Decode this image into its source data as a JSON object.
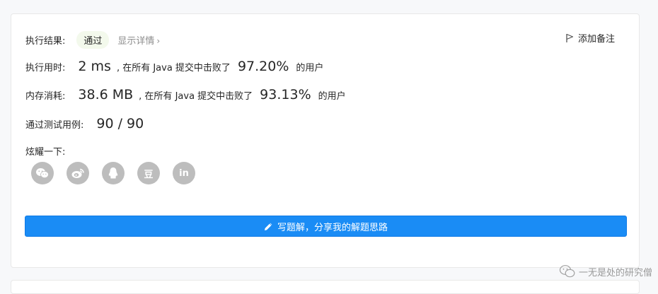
{
  "result": {
    "label": "执行结果:",
    "status": "通过",
    "details_link": "显示详情",
    "details_chevron": "›"
  },
  "add_note": {
    "label": "添加备注"
  },
  "runtime": {
    "label": "执行用时:",
    "value": "2 ms",
    "beat_text": ", 在所有 Java 提交中击败了",
    "percent": "97.20%",
    "users_text": "的用户"
  },
  "memory": {
    "label": "内存消耗:",
    "value": "38.6 MB",
    "beat_text": ", 在所有 Java 提交中击败了",
    "percent": "93.13%",
    "users_text": "的用户"
  },
  "testcases": {
    "label": "通过测试用例:",
    "value": "90 / 90"
  },
  "share": {
    "label": "炫耀一下:",
    "icons": [
      "wechat-icon",
      "weibo-icon",
      "qq-icon",
      "douban-icon",
      "linkedin-icon"
    ],
    "douban_glyph": "豆",
    "linkedin_glyph": "in"
  },
  "solution_button": {
    "label": "写题解，分享我的解题思路"
  },
  "watermark": {
    "text": "一无是处的研究僧"
  },
  "colors": {
    "accent": "#1a8cf5",
    "pass_badge_bg": "#f3f9ec",
    "icon_gray": "#bdbdbd"
  }
}
